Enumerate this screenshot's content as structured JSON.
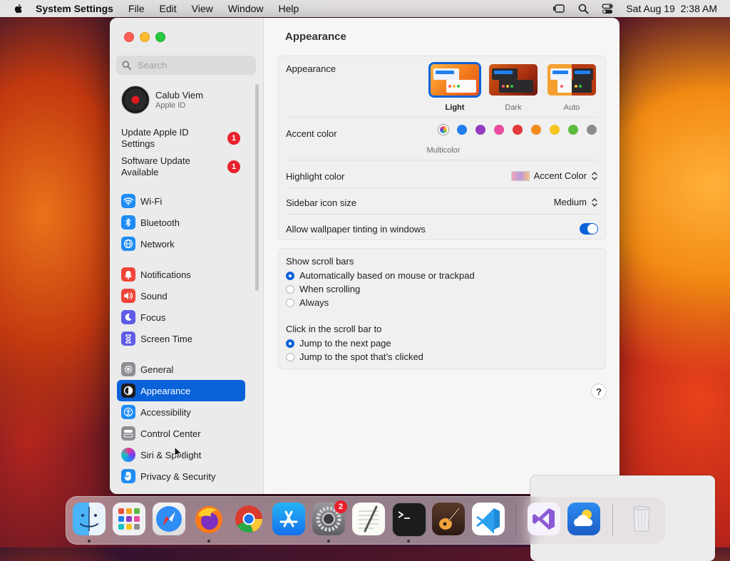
{
  "menubar": {
    "app_name": "System Settings",
    "menus": [
      "File",
      "Edit",
      "View",
      "Window",
      "Help"
    ],
    "datetime": "Sat Aug 19  2:38 AM"
  },
  "sidebar": {
    "search_placeholder": "Search",
    "account": {
      "name": "Calub Viem",
      "subtitle": "Apple ID"
    },
    "notices": [
      {
        "label": "Update Apple ID Settings",
        "badge": "1"
      },
      {
        "label": "Software Update Available",
        "badge": "1"
      }
    ],
    "items": [
      {
        "label": "Wi-Fi",
        "icon": "wifi-icon",
        "color": "#1f8cf5"
      },
      {
        "label": "Bluetooth",
        "icon": "bluetooth-icon",
        "color": "#1f8cf5"
      },
      {
        "label": "Network",
        "icon": "globe-icon",
        "color": "#1f8cf5"
      },
      {
        "label": "Notifications",
        "icon": "bell-icon",
        "color": "#f0443a"
      },
      {
        "label": "Sound",
        "icon": "speaker-icon",
        "color": "#f0443a"
      },
      {
        "label": "Focus",
        "icon": "moon-icon",
        "color": "#5e5ce6"
      },
      {
        "label": "Screen Time",
        "icon": "hourglass-icon",
        "color": "#5e5ce6"
      },
      {
        "label": "General",
        "icon": "gear-icon",
        "color": "#8e8e93"
      },
      {
        "label": "Appearance",
        "icon": "appearance-icon",
        "color": "#1c1c1e",
        "active": true
      },
      {
        "label": "Accessibility",
        "icon": "accessibility-icon",
        "color": "#1f8cf5"
      },
      {
        "label": "Control Center",
        "icon": "control-center-icon",
        "color": "#8e8e93"
      },
      {
        "label": "Siri & Spotlight",
        "icon": "siri-icon",
        "color": "#7a3cf0"
      },
      {
        "label": "Privacy & Security",
        "icon": "hand-icon",
        "color": "#1f8cf5"
      }
    ]
  },
  "main": {
    "title": "Appearance",
    "appearance": {
      "label": "Appearance",
      "options": [
        {
          "label": "Light",
          "selected": true
        },
        {
          "label": "Dark",
          "selected": false
        },
        {
          "label": "Auto",
          "selected": false
        }
      ]
    },
    "accent": {
      "label": "Accent color",
      "selected_caption": "Multicolor",
      "colors": [
        "multicolor",
        "#1f7ff0",
        "#933cc2",
        "#ea4aa0",
        "#e23a3a",
        "#f18a1c",
        "#f6c41e",
        "#5dbb3f",
        "#8c8c8c"
      ]
    },
    "highlight": {
      "label": "Highlight color",
      "value": "Accent Color"
    },
    "icon_size": {
      "label": "Sidebar icon size",
      "value": "Medium"
    },
    "tinting": {
      "label": "Allow wallpaper tinting in windows",
      "enabled": true
    },
    "scroll_bars": {
      "label": "Show scroll bars",
      "options": [
        {
          "label": "Automatically based on mouse or trackpad",
          "selected": true
        },
        {
          "label": "When scrolling",
          "selected": false
        },
        {
          "label": "Always",
          "selected": false
        }
      ]
    },
    "click_scroll": {
      "label": "Click in the scroll bar to",
      "options": [
        {
          "label": "Jump to the next page",
          "selected": true
        },
        {
          "label": "Jump to the spot that’s clicked",
          "selected": false
        }
      ]
    },
    "help_label": "?"
  },
  "dock": {
    "apps": [
      "Finder",
      "Launchpad",
      "Safari",
      "Firefox",
      "Chrome",
      "App Store",
      "System Settings",
      "TextEdit",
      "Terminal",
      "GarageBand",
      "VS Code",
      "Visual Studio",
      "Weather",
      "Trash"
    ],
    "system_settings_badge": "2"
  }
}
